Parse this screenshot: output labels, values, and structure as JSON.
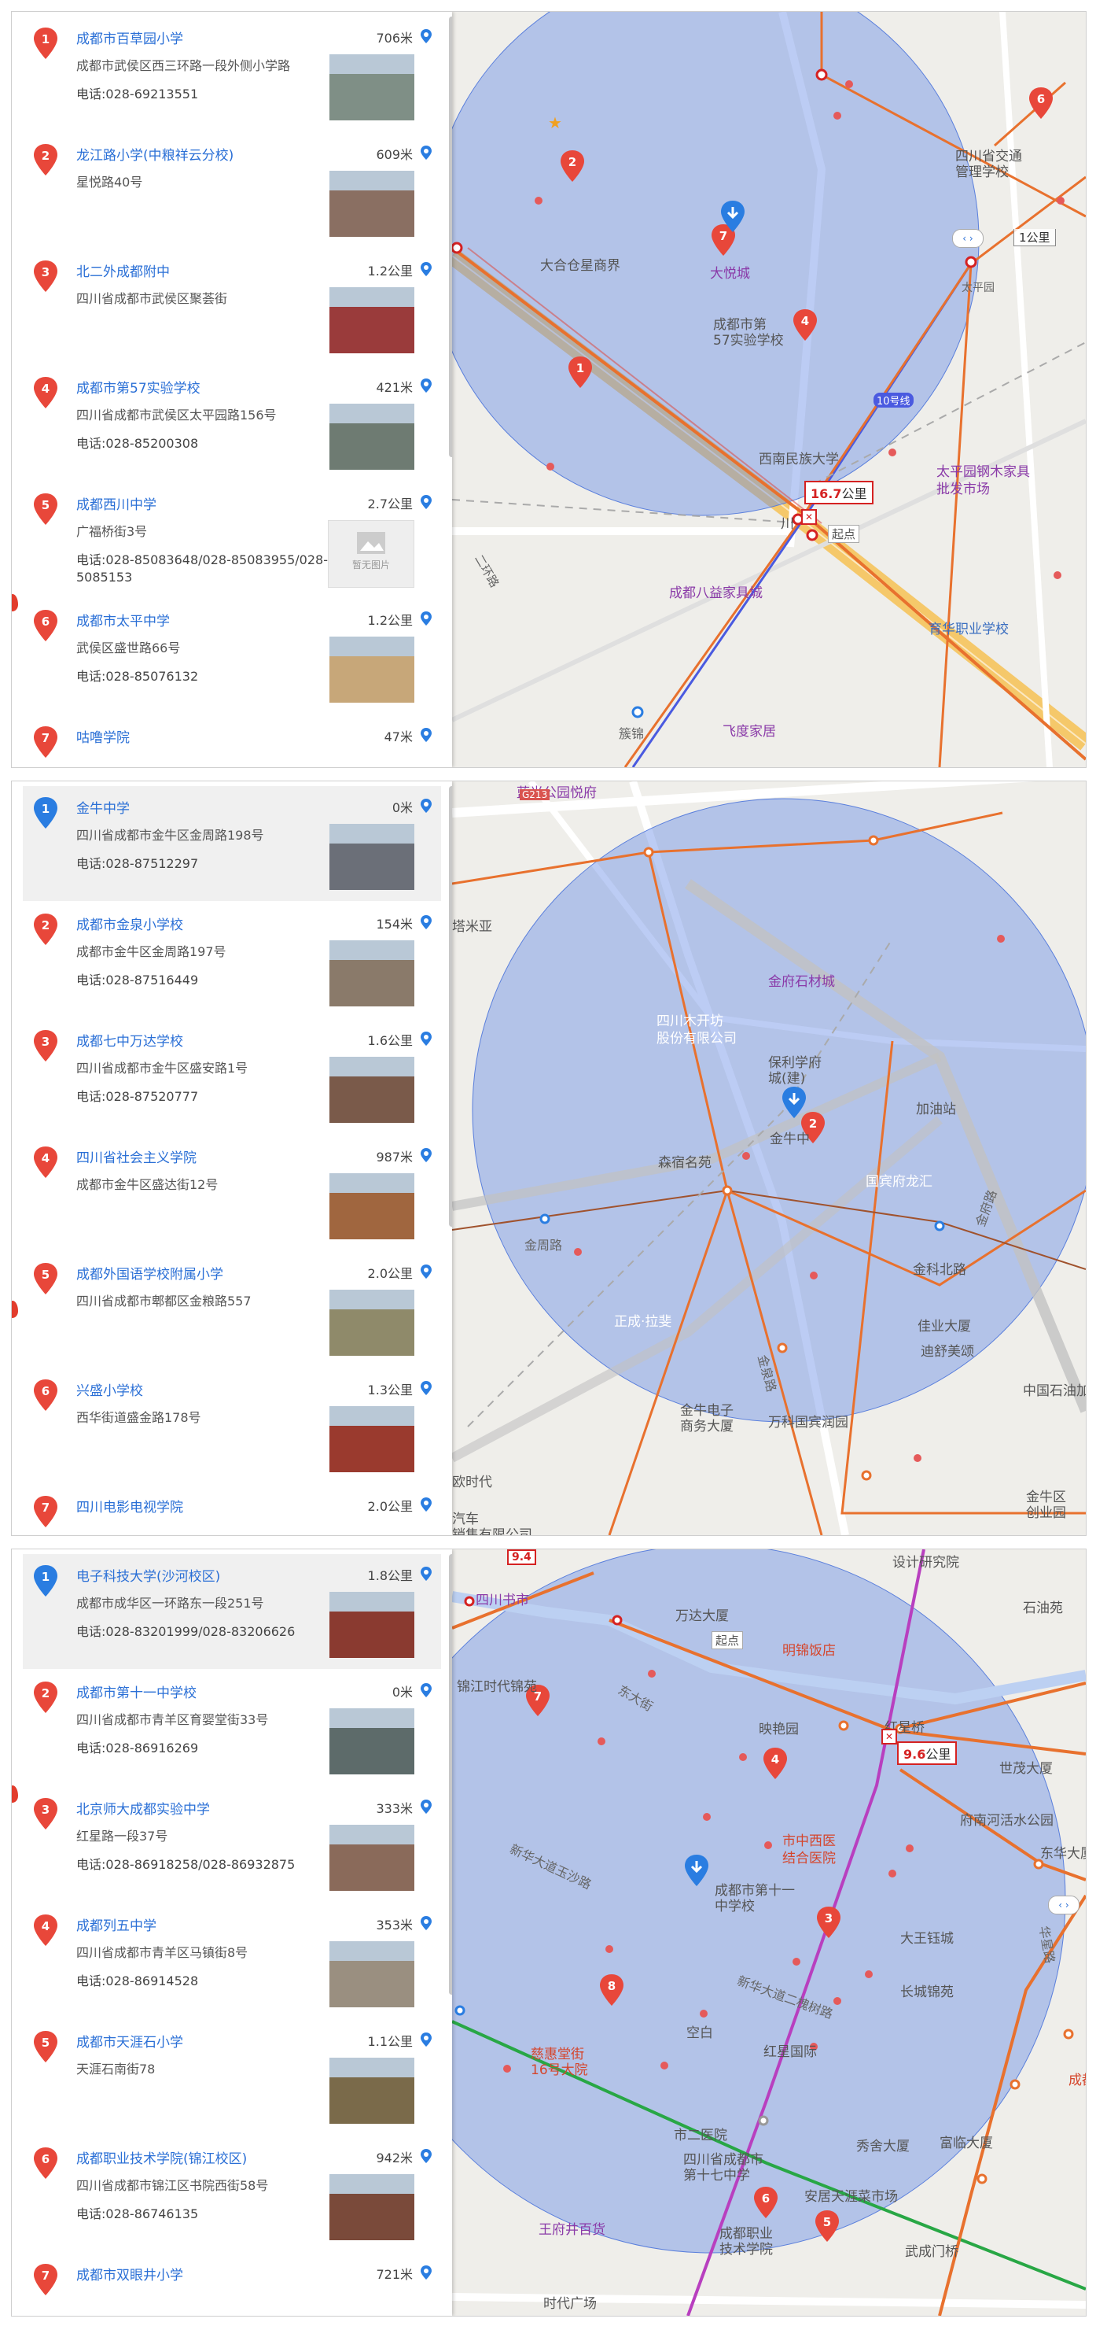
{
  "panels": [
    {
      "items": [
        {
          "num": "1",
          "color": "#e8473a",
          "name": "成都市百草园小学",
          "dist": "706米",
          "addr": "成都市武侯区西三环路一段外侧小学路",
          "tel": "电话:028-69213551",
          "thumb": "#7f8f86"
        },
        {
          "num": "2",
          "color": "#e8473a",
          "name": "龙江路小学(中粮祥云分校)",
          "dist": "609米",
          "addr": "星悦路40号",
          "tel": "",
          "thumb": "#8a6f62"
        },
        {
          "num": "3",
          "color": "#e8473a",
          "name": "北二外成都附中",
          "dist": "1.2公里",
          "addr": "四川省成都市武侯区聚荟街",
          "tel": "",
          "thumb": "#9a3b3b"
        },
        {
          "num": "4",
          "color": "#e8473a",
          "name": "成都市第57实验学校",
          "dist": "421米",
          "addr": "四川省成都市武侯区太平园路156号",
          "tel": "电话:028-85200308",
          "thumb": "#6e7b72"
        },
        {
          "num": "5",
          "color": "#e8473a",
          "name": "成都西川中学",
          "dist": "2.7公里",
          "addr": "广福桥街3号",
          "tel": "电话:028-85083648/028-85083955/028-85085153",
          "thumb": "none"
        },
        {
          "num": "6",
          "color": "#e8473a",
          "name": "成都市太平中学",
          "dist": "1.2公里",
          "addr": "武侯区盛世路66号",
          "tel": "电话:028-85076132",
          "thumb": "#c7a779"
        },
        {
          "num": "7",
          "color": "#e8473a",
          "name": "咕噜学院",
          "dist": "47米",
          "addr": "",
          "tel": "",
          "thumb": ""
        }
      ],
      "noimg_label": "暂无图片",
      "map_labels": {
        "l1": "大合仓星商界",
        "l2": "大悦城",
        "l3": "成都市第\n57实验学校",
        "l4": "四川省交通\n管理学校",
        "l5": "西南民族大学",
        "l6": "川",
        "l7": "太平园钢木家具\n批发市场",
        "l8": "成都八益家具城",
        "l9": "育华职业学校",
        "l10": "飞度家居",
        "l11": "簇锦",
        "l12": "10号线",
        "l13": "起点",
        "l14": "太平园",
        "l15": "二环路"
      },
      "dist_tag": {
        "value": "16.7",
        "unit": "公里"
      },
      "scale": "1公里",
      "pins": [
        "1",
        "2",
        "4",
        "6",
        "7"
      ]
    },
    {
      "items": [
        {
          "num": "1",
          "color": "#2a7de1",
          "name": "金牛中学",
          "dist": "0米",
          "addr": "四川省成都市金牛区金周路198号",
          "tel": "电话:028-87512297",
          "thumb": "#6b6f78"
        },
        {
          "num": "2",
          "color": "#e8473a",
          "name": "成都市金泉小学校",
          "dist": "154米",
          "addr": "成都市金牛区金周路197号",
          "tel": "电话:028-87516449",
          "thumb": "#8a7a6a"
        },
        {
          "num": "3",
          "color": "#e8473a",
          "name": "成都七中万达学校",
          "dist": "1.6公里",
          "addr": "四川省成都市金牛区盛安路1号",
          "tel": "电话:028-87520777",
          "thumb": "#7a5a4a"
        },
        {
          "num": "4",
          "color": "#e8473a",
          "name": "四川省社会主义学院",
          "dist": "987米",
          "addr": "成都市金牛区盛达街12号",
          "tel": "",
          "thumb": "#a0663f"
        },
        {
          "num": "5",
          "color": "#e8473a",
          "name": "成都外国语学校附属小学",
          "dist": "2.0公里",
          "addr": "四川省成都市郫都区金粮路557",
          "tel": "",
          "thumb": "#8f8a6a"
        },
        {
          "num": "6",
          "color": "#e8473a",
          "name": "兴盛小学校",
          "dist": "1.3公里",
          "addr": "西华街道盛金路178号",
          "tel": "",
          "thumb": "#9a3a2e"
        },
        {
          "num": "7",
          "color": "#e8473a",
          "name": "四川电影电视学院",
          "dist": "2.0公里",
          "addr": "",
          "tel": "",
          "thumb": ""
        }
      ],
      "map_labels": {
        "l1": "蓝光公园悦府",
        "l2": "金府石材城",
        "l3": "四川木开坊\n股份有限公司",
        "l4": "保利学府\n城(建)",
        "l5": "加油站",
        "l6": "森宿名苑",
        "l7": "金牛中",
        "l8": "国宾府龙汇",
        "l9": "金周路",
        "l10": "金科北路",
        "l11": "佳业大厦",
        "l12": "迪舒美颂",
        "l13": "正成·拉斐",
        "l14": "金牛电子\n商务大厦",
        "l15": "万科国宾润园",
        "l16": "中国石油加",
        "l17": "金牛区\n创业园",
        "l18": "欧时代",
        "l19": "汽车\n销售有限公司",
        "l20": "金泉路",
        "l21": "金府路",
        "l22": "塔米亚",
        "l23": "G213"
      },
      "pins": [
        "2"
      ]
    },
    {
      "items": [
        {
          "num": "1",
          "color": "#2a7de1",
          "name": "电子科技大学(沙河校区)",
          "dist": "1.8公里",
          "addr": "成都市成华区一环路东一段251号",
          "tel": "电话:028-83201999/028-83206626",
          "thumb": "#8a3a30"
        },
        {
          "num": "2",
          "color": "#e8473a",
          "name": "成都市第十一中学校",
          "dist": "0米",
          "addr": "四川省成都市青羊区育婴堂街33号",
          "tel": "电话:028-86916269",
          "thumb": "#5d6b6a"
        },
        {
          "num": "3",
          "color": "#e8473a",
          "name": "北京师大成都实验中学",
          "dist": "333米",
          "addr": "红星路一段37号",
          "tel": "电话:028-86918258/028-86932875",
          "thumb": "#8a6a5a"
        },
        {
          "num": "4",
          "color": "#e8473a",
          "name": "成都列五中学",
          "dist": "353米",
          "addr": "四川省成都市青羊区马镇街8号",
          "tel": "电话:028-86914528",
          "thumb": "#9a8f80"
        },
        {
          "num": "5",
          "color": "#e8473a",
          "name": "成都市天涯石小学",
          "dist": "1.1公里",
          "addr": "天涯石南街78",
          "tel": "",
          "thumb": "#7a6a4a"
        },
        {
          "num": "6",
          "color": "#e8473a",
          "name": "成都职业技术学院(锦江校区)",
          "dist": "942米",
          "addr": "四川省成都市锦江区书院西街58号",
          "tel": "电话:028-86746135",
          "thumb": "#7a4a3a"
        },
        {
          "num": "7",
          "color": "#e8473a",
          "name": "成都市双眼井小学",
          "dist": "721米",
          "addr": "",
          "tel": "",
          "thumb": ""
        }
      ],
      "map_labels": {
        "l1": "四川书市",
        "l2": "万达大厦",
        "l3": "明锦饭店",
        "l4": "设计研究院",
        "l5": "石油苑",
        "l6": "锦江时代锦苑",
        "l7": "映艳园",
        "l8": "红星桥",
        "l9": "世茂大厦",
        "l10": "府南河活水公园",
        "l11": "东华大厦",
        "l12": "市中西医\n结合医院",
        "l13": "成都市第十一\n中学校",
        "l14": "大王钰城",
        "l15": "新华大道二槐树路",
        "l16": "长城锦苑",
        "l17": "红星国际",
        "l18": "空白",
        "l19": "慈惠堂街\n16号大院",
        "l20": "市二医院",
        "l21": "四川省成都市\n第十七中学",
        "l22": "秀舍大厦",
        "l23": "安居天涯菜市场",
        "l24": "富临大厦",
        "l25": "成都职业\n技术学院",
        "l26": "王府井百货",
        "l27": "武成门桥",
        "l28": "时代广场",
        "l29": "起点",
        "l30": "华星路",
        "l31": "新华大道玉沙路",
        "l32": "东大街",
        "l33": "成都",
        "l34": "9.4"
      },
      "dist_tag": {
        "value": "9.6",
        "unit": "公里"
      },
      "pins": [
        "3",
        "4",
        "5",
        "6",
        "7",
        "8"
      ]
    }
  ]
}
